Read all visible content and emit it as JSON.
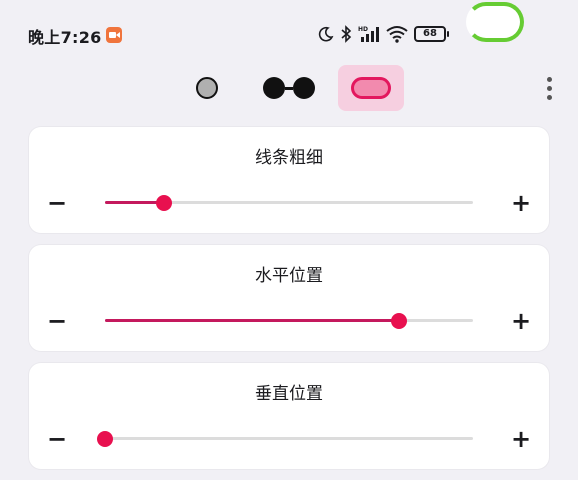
{
  "status_bar": {
    "time": "晚上7:26",
    "battery": "68",
    "icons": [
      "moon-icon",
      "bluetooth-icon",
      "hd-signal-icon",
      "wifi-icon",
      "battery-icon"
    ]
  },
  "toolbar": {
    "tools": [
      {
        "name": "single-circle",
        "icon": "circle-icon",
        "active": false
      },
      {
        "name": "double-circle",
        "icon": "glasses-icon",
        "active": false
      },
      {
        "name": "capsule",
        "icon": "capsule-icon",
        "active": true
      }
    ],
    "more_icon": "more-vertical-icon"
  },
  "sliders": [
    {
      "title": "线条粗细",
      "minus": "−",
      "plus": "+",
      "value": 0.16
    },
    {
      "title": "水平位置",
      "minus": "−",
      "plus": "+",
      "value": 0.8
    },
    {
      "title": "垂直位置",
      "minus": "−",
      "plus": "+",
      "value": 0.0
    }
  ],
  "colors": {
    "accent": "#e8104f",
    "fill": "#c4195d",
    "active_tool_bg": "#f6cfe0",
    "record_badge": "#f0743c",
    "green_indicator": "#66cc33"
  }
}
